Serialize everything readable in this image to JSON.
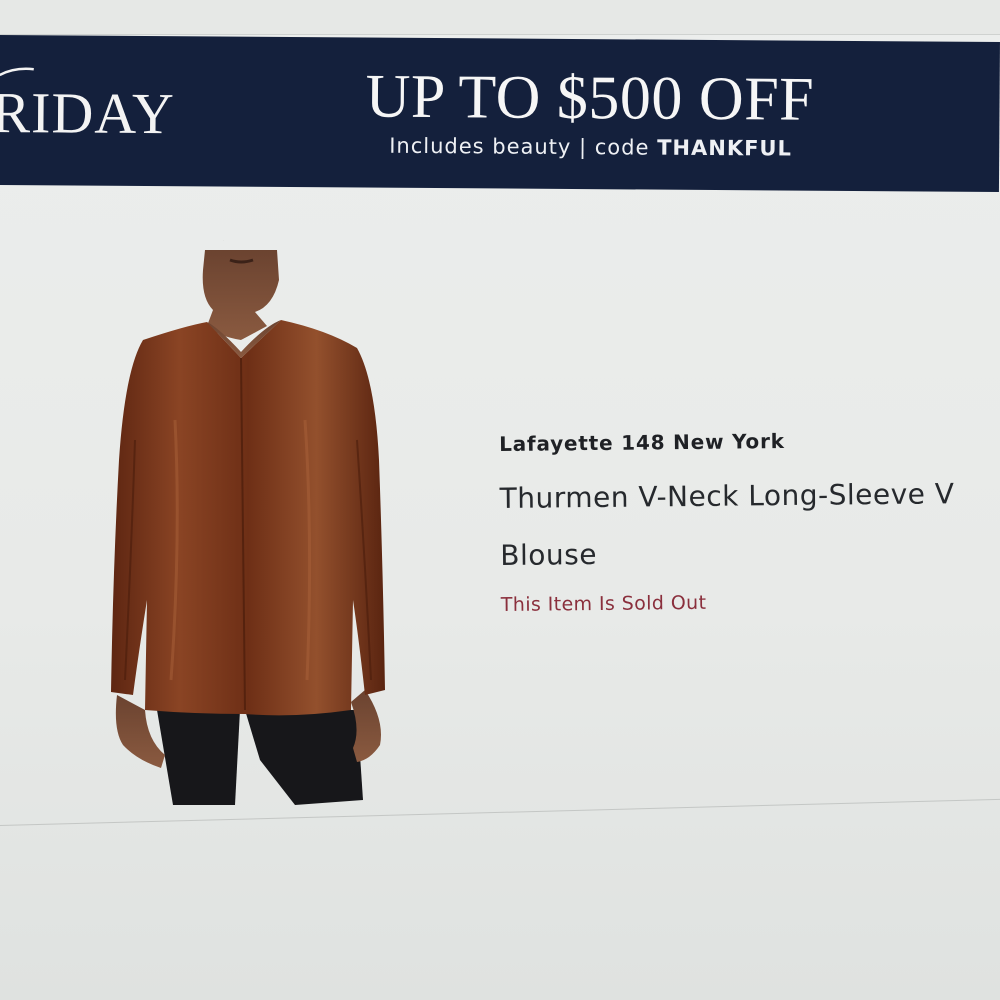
{
  "promo_banner": {
    "event_name": "RIDAY",
    "headline": "UP TO $500 OFF",
    "subline_prefix": "Includes beauty | code ",
    "code": "THANKFUL"
  },
  "product": {
    "brand": "Lafayette 148 New York",
    "title_line1": "Thurmen V-Neck Long-Sleeve V",
    "title_line2": "Blouse",
    "stock_status": "This Item Is Sold Out"
  },
  "colors": {
    "banner_bg": "#14203c",
    "page_bg": "#eceeed",
    "sold_out": "#8a2f3c",
    "garment": "#7a3a1e"
  }
}
